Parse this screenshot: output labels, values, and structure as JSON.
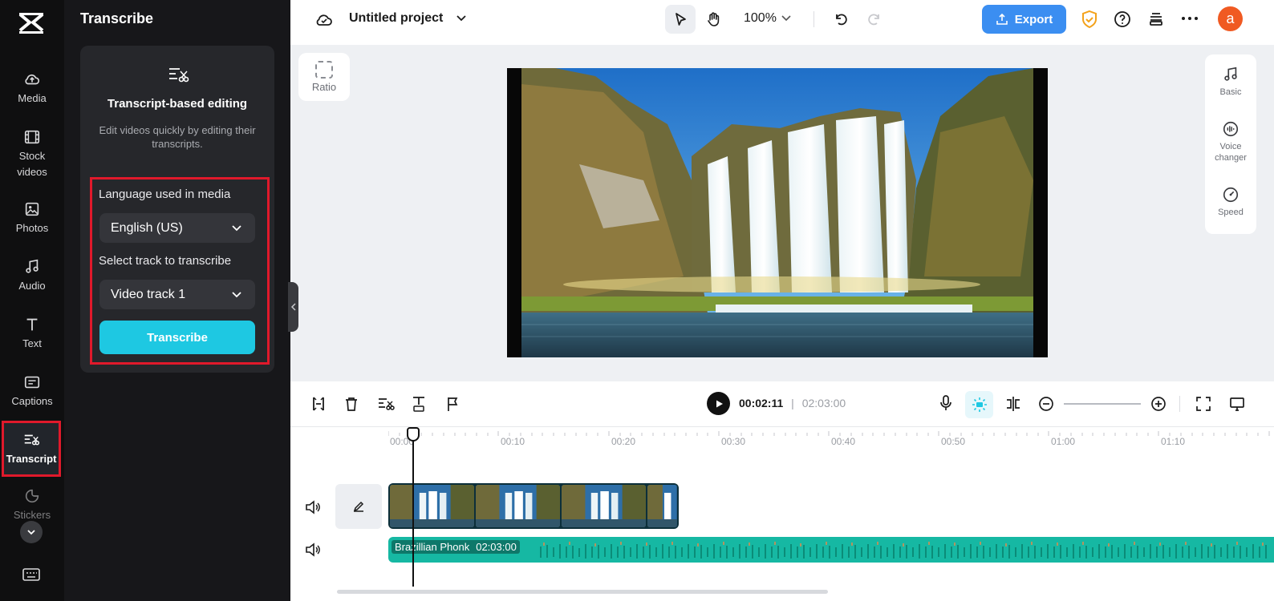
{
  "rail": {
    "items": [
      {
        "label": "Media",
        "icon": "cloud-upload-icon"
      },
      {
        "label": "Stock\nvideos",
        "icon": "film-icon"
      },
      {
        "label": "Photos",
        "icon": "image-icon"
      },
      {
        "label": "Audio",
        "icon": "music-note-icon"
      },
      {
        "label": "Text",
        "icon": "text-t-icon"
      },
      {
        "label": "Captions",
        "icon": "captions-icon"
      },
      {
        "label": "Transcript",
        "icon": "transcript-icon"
      },
      {
        "label": "Stickers",
        "icon": "sticker-icon"
      }
    ]
  },
  "panel": {
    "title": "Transcribe",
    "card_title": "Transcript-based editing",
    "card_desc": "Edit videos quickly by editing their transcripts.",
    "language_label": "Language used in media",
    "language_value": "English (US)",
    "track_label": "Select track to transcribe",
    "track_value": "Video track 1",
    "transcribe_button": "Transcribe"
  },
  "topbar": {
    "project_name": "Untitled project",
    "zoom": "100%",
    "export_label": "Export",
    "avatar_letter": "a"
  },
  "canvas": {
    "ratio_label": "Ratio"
  },
  "properties": {
    "items": [
      {
        "label": "Basic",
        "icon": "music-note-icon"
      },
      {
        "label": "Voice changer",
        "icon": "voice-changer-icon"
      },
      {
        "label": "Speed",
        "icon": "speed-gauge-icon"
      }
    ]
  },
  "timeline": {
    "current_time": "00:02:11",
    "total_time": "02:03:00",
    "ruler": [
      "00:00",
      "00:10",
      "00:20",
      "00:30",
      "00:40",
      "00:50",
      "01:00",
      "01:10"
    ],
    "audio_track_name": "Brazillian Phonk",
    "audio_track_duration": "02:03:00"
  },
  "colors": {
    "accent": "#1ec8e2",
    "export": "#3b8ef1",
    "highlight": "#e0192b",
    "audio": "#16b8a3"
  }
}
